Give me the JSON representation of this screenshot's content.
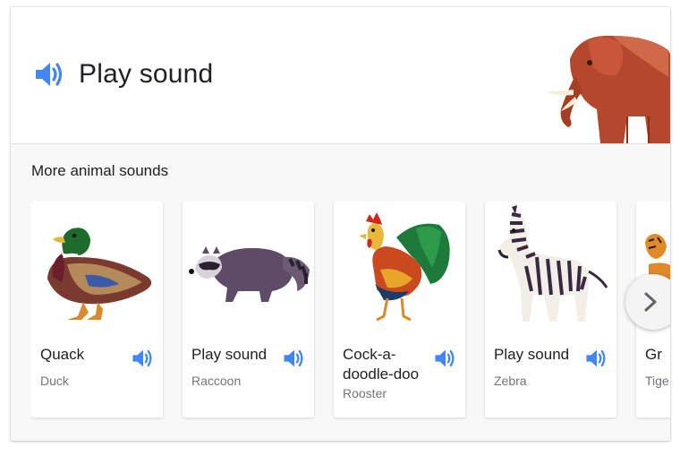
{
  "hero": {
    "play_label": "Play sound",
    "icon": "speaker-icon",
    "illustration": "elephant"
  },
  "section": {
    "title": "More animal sounds"
  },
  "animals": [
    {
      "sound": "Quack",
      "name": "Duck",
      "icon": "speaker-icon"
    },
    {
      "sound": "Play sound",
      "name": "Raccoon",
      "icon": "speaker-icon"
    },
    {
      "sound": "Cock-a-doodle-doo",
      "name": "Rooster",
      "icon": "speaker-icon"
    },
    {
      "sound": "Play sound",
      "name": "Zebra",
      "icon": "speaker-icon"
    },
    {
      "sound": "Gr",
      "name": "Tige",
      "icon": "speaker-icon"
    }
  ],
  "carousel": {
    "next_icon": "chevron-right-icon"
  },
  "colors": {
    "accent": "#4285f4",
    "card_bg": "#f8f8f8",
    "tile_bg": "#ffffff",
    "secondary_text": "#70757a"
  }
}
